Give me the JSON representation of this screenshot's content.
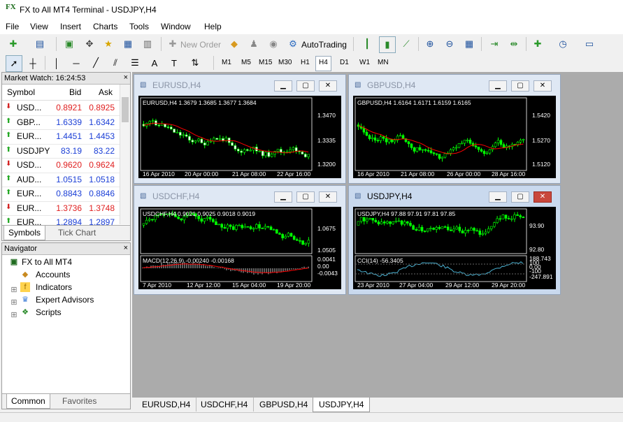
{
  "window": {
    "title": "FX to All MT4 Terminal - USDJPY,H4",
    "logo": "FX"
  },
  "menu": [
    "File",
    "View",
    "Insert",
    "Charts",
    "Tools",
    "Window",
    "Help"
  ],
  "toolbar": {
    "new_order": "New Order",
    "autotrading": "AutoTrading"
  },
  "timeframes": [
    "M1",
    "M5",
    "M15",
    "M30",
    "H1",
    "H4",
    "D1",
    "W1",
    "MN"
  ],
  "active_timeframe": "H4",
  "market_watch": {
    "title": "Market Watch: 16:24:53",
    "headers": {
      "symbol": "Symbol",
      "bid": "Bid",
      "ask": "Ask"
    },
    "rows": [
      {
        "symbol": "USD...",
        "bid": "0.8921",
        "ask": "0.8925",
        "dir": "down"
      },
      {
        "symbol": "GBP...",
        "bid": "1.6339",
        "ask": "1.6342",
        "dir": "up"
      },
      {
        "symbol": "EUR...",
        "bid": "1.4451",
        "ask": "1.4453",
        "dir": "up"
      },
      {
        "symbol": "USDJPY",
        "bid": "83.19",
        "ask": "83.22",
        "dir": "up"
      },
      {
        "symbol": "USD...",
        "bid": "0.9620",
        "ask": "0.9624",
        "dir": "down"
      },
      {
        "symbol": "AUD...",
        "bid": "1.0515",
        "ask": "1.0518",
        "dir": "up"
      },
      {
        "symbol": "EUR...",
        "bid": "0.8843",
        "ask": "0.8846",
        "dir": "up"
      },
      {
        "symbol": "EUR...",
        "bid": "1.3736",
        "ask": "1.3748",
        "dir": "down"
      },
      {
        "symbol": "EUR...",
        "bid": "1.2894",
        "ask": "1.2897",
        "dir": "up"
      }
    ],
    "tabs": [
      "Symbols",
      "Tick Chart"
    ]
  },
  "navigator": {
    "title": "Navigator",
    "root": "FX to All MT4",
    "items": [
      "Accounts",
      "Indicators",
      "Expert Advisors",
      "Scripts"
    ],
    "tabs": [
      "Common",
      "Favorites"
    ]
  },
  "charts": [
    {
      "window_title": "EURUSD,H4",
      "info": "EURUSD,H4  1.3679 1.3685 1.3677 1.3684",
      "prices": [
        "1.3470",
        "1.3335",
        "1.3200"
      ],
      "dates": [
        "16 Apr 2010",
        "20 Apr 00:00",
        "21 Apr 08:00",
        "22 Apr 16:00"
      ],
      "up": "#00ff00",
      "down": "#ffffff",
      "ma": "#ff0000"
    },
    {
      "window_title": "GBPUSD,H4",
      "info": "GBPUSD,H4  1.6164 1.6171 1.6159 1.6165",
      "prices": [
        "1.5420",
        "1.5270",
        "1.5120"
      ],
      "dates": [
        "16 Apr 2010",
        "21 Apr 08:00",
        "26 Apr 00:00",
        "28 Apr 16:00"
      ],
      "up": "#00ff00",
      "down": "#00ff00",
      "ma": "#ff0000"
    },
    {
      "window_title": "USDCHF,H4",
      "info": "USDCHF,H4  0.9021 0.9025 0.9018 0.9019",
      "prices": [
        "1.0675",
        "1.0505"
      ],
      "indicator": "MACD(12,26,9) -0.00240 -0.00168",
      "ind_levels": [
        "0.0041",
        "0.00",
        "-0.0043"
      ],
      "dates": [
        "7 Apr 2010",
        "12 Apr 12:00",
        "15 Apr 04:00",
        "19 Apr 20:00"
      ]
    },
    {
      "window_title": "USDJPY,H4",
      "info": "USDJPY,H4  97.88 97.91 97.81 97.85",
      "prices": [
        "93.90",
        "92.80"
      ],
      "indicator": "CCI(14) -56.3405",
      "ind_levels": [
        "188.743",
        "100",
        "0.00",
        "-100",
        "-247.891"
      ],
      "dates": [
        "23 Apr 2010",
        "27 Apr 04:00",
        "29 Apr 12:00",
        "29 Apr 20:00"
      ]
    }
  ],
  "chart_tabs": [
    "EURUSD,H4",
    "USDCHF,H4",
    "GBPUSD,H4",
    "USDJPY,H4"
  ],
  "active_chart_tab": "USDJPY,H4"
}
